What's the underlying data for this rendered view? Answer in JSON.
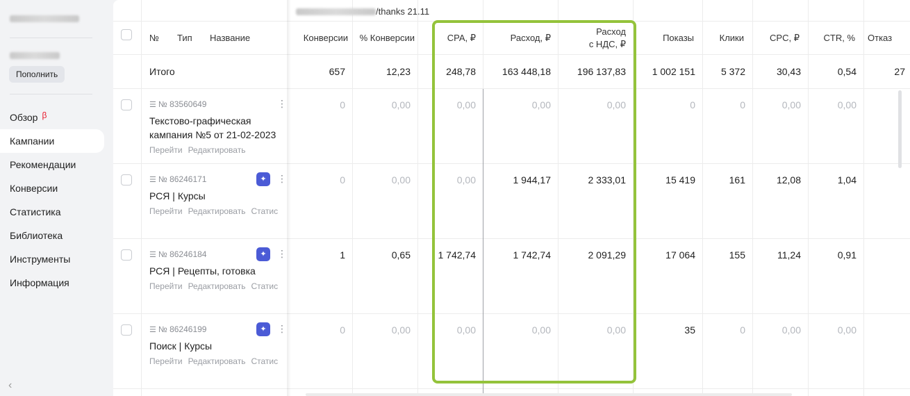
{
  "sidebar": {
    "account_name": "galaxian 13100",
    "balance": "",
    "topup_label": "Пополнить",
    "nav": [
      {
        "label": "Обзор",
        "badge": "β"
      },
      {
        "label": "Кампании"
      },
      {
        "label": "Рекомендации"
      },
      {
        "label": "Конверсии"
      },
      {
        "label": "Статистика"
      },
      {
        "label": "Библиотека"
      },
      {
        "label": "Инструменты"
      },
      {
        "label": "Информация"
      }
    ],
    "collapse_icon": "‹"
  },
  "goal": {
    "label": "/thanks 21.11"
  },
  "columns": {
    "number": "№",
    "type": "Тип",
    "name": "Название",
    "conversions": "Конверсии",
    "conv_rate": "% Конверсии",
    "cpa": "CPA, ₽",
    "spend": "Расход, ₽",
    "spend_vat_1": "Расход",
    "spend_vat_2": "с НДС, ₽",
    "impressions": "Показы",
    "clicks": "Клики",
    "cpc": "CPC, ₽",
    "ctr": "CTR, %",
    "bounce": "Отказ"
  },
  "total": {
    "label": "Итого",
    "conversions": "657",
    "conv_rate": "12,23",
    "cpa": "248,78",
    "spend": "163 448,18",
    "spend_vat": "196 137,83",
    "impressions": "1 002 151",
    "clicks": "5 372",
    "cpc": "30,43",
    "ctr": "0,54",
    "bounce": "27"
  },
  "links": {
    "go": "Перейти",
    "edit": "Редактировать",
    "stats": "Статис"
  },
  "campaigns": [
    {
      "id": "№ 83560649",
      "name_1": "Текстово-графическая",
      "name_2": "кампания №5 от 21-02-2023",
      "conversions": "0",
      "conv_rate": "0,00",
      "cpa": "0,00",
      "spend": "0,00",
      "spend_vat": "0,00",
      "impressions": "0",
      "clicks": "0",
      "cpc": "0,00",
      "ctr": "0,00"
    },
    {
      "id": "№ 86246171",
      "name_1": "РСЯ | Курсы",
      "name_2": "",
      "conversions": "0",
      "conv_rate": "0,00",
      "cpa": "0,00",
      "spend": "1 944,17",
      "spend_vat": "2 333,01",
      "impressions": "15 419",
      "clicks": "161",
      "cpc": "12,08",
      "ctr": "1,04"
    },
    {
      "id": "№ 86246184",
      "name_1": "РСЯ | Рецепты, готовка",
      "name_2": "",
      "conversions": "1",
      "conv_rate": "0,65",
      "cpa": "1 742,74",
      "spend": "1 742,74",
      "spend_vat": "2 091,29",
      "impressions": "17 064",
      "clicks": "155",
      "cpc": "11,24",
      "ctr": "0,91"
    },
    {
      "id": "№ 86246199",
      "name_1": "Поиск | Курсы",
      "name_2": "",
      "conversions": "0",
      "conv_rate": "0,00",
      "cpa": "0,00",
      "spend": "0,00",
      "spend_vat": "0,00",
      "impressions": "35",
      "clicks": "0",
      "cpc": "0,00",
      "ctr": "0,00"
    }
  ],
  "icons": {
    "type": "text-campaign-icon",
    "sparkle": "sparkle-icon",
    "kebab": "kebab-menu-icon"
  },
  "colors": {
    "highlight": "#94c33b",
    "sparkle_bg": "#4b5bd6",
    "beta": "#e8192c"
  }
}
